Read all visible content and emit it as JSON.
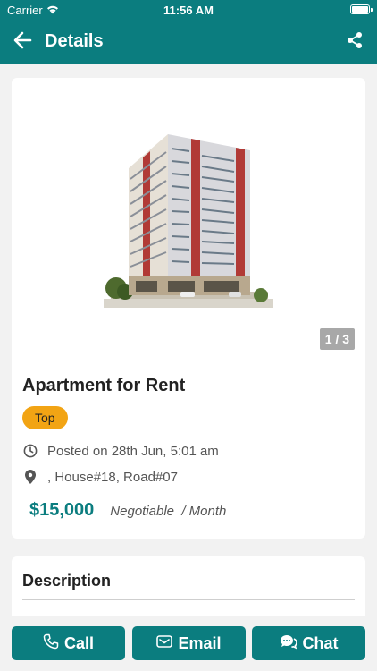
{
  "status_bar": {
    "carrier": "Carrier",
    "time": "11:56 AM"
  },
  "nav": {
    "title": "Details",
    "back_icon": "arrow-left-icon",
    "share_icon": "share-icon"
  },
  "gallery": {
    "pager": "1 / 3",
    "image": "apartment-building"
  },
  "listing": {
    "title": "Apartment for Rent",
    "badge": "Top",
    "posted": "Posted on 28th Jun, 5:01 am",
    "location": ", House#18, Road#07",
    "price": "$15,000",
    "price_note": "Negotiable  / Month"
  },
  "description": {
    "title": "Description"
  },
  "actions": {
    "call": "Call",
    "email": "Email",
    "chat": "Chat"
  },
  "colors": {
    "primary": "#0b7d7f",
    "badge": "#f2a414"
  }
}
